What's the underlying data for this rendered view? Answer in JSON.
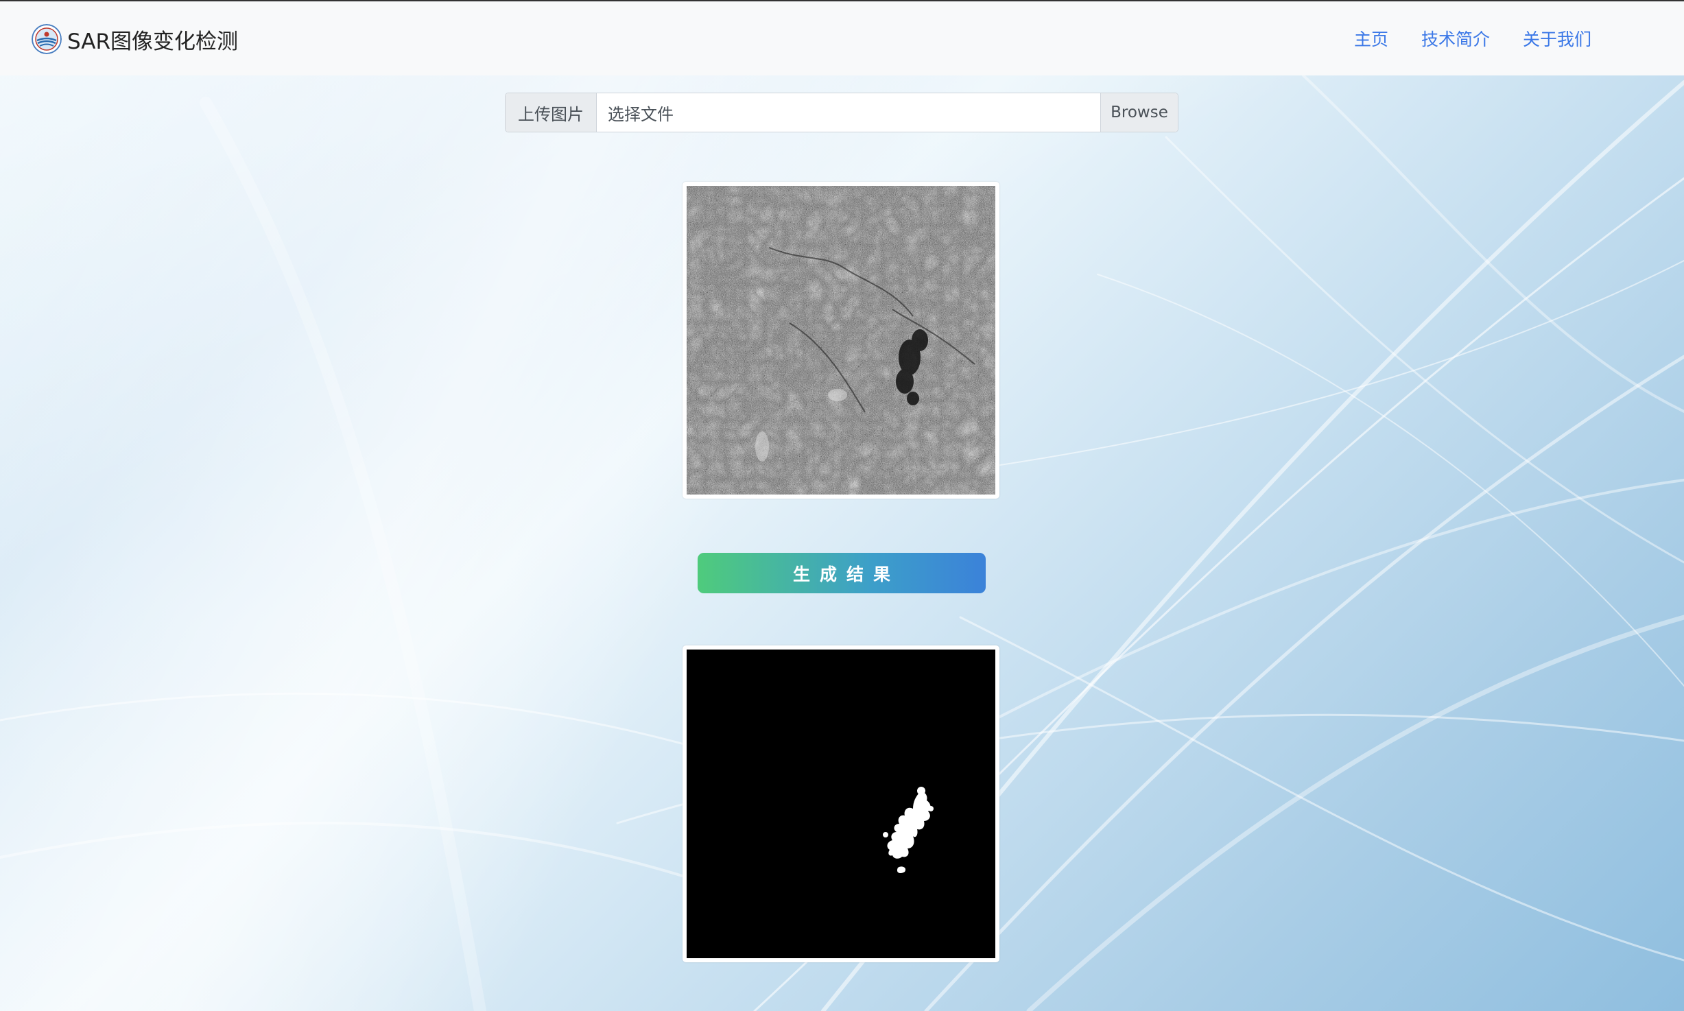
{
  "navbar": {
    "brand_title": "SAR图像变化检测",
    "links": [
      "主页",
      "技术简介",
      "关于我们"
    ]
  },
  "upload": {
    "label": "上传图片",
    "file_placeholder": "选择文件",
    "browse_label": "Browse"
  },
  "generate_button_label": "生成结果",
  "images": {
    "input_icon": "sar-satellite-image",
    "output_icon": "change-detection-mask"
  },
  "colors": {
    "nav_link": "#3b78e7",
    "button_gradient_start": "#4fcb7c",
    "button_gradient_end": "#3b82d9"
  }
}
